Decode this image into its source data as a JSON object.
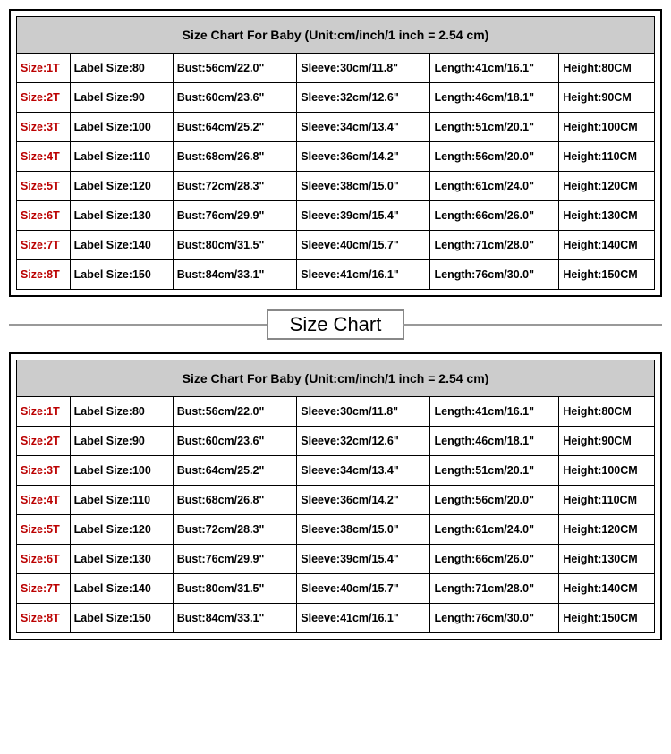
{
  "chart_data": {
    "type": "table",
    "title": "Size Chart For Baby (Unit:cm/inch/1 inch = 2.54 cm)",
    "columns": [
      "Size",
      "Label Size",
      "Bust",
      "Sleeve",
      "Length",
      "Height"
    ],
    "rows": [
      {
        "size": "1T",
        "label": "80",
        "bust": "56cm/22.0\"",
        "sleeve": "30cm/11.8\"",
        "length": "41cm/16.1\"",
        "height": "80CM"
      },
      {
        "size": "2T",
        "label": "90",
        "bust": "60cm/23.6\"",
        "sleeve": "32cm/12.6\"",
        "length": "46cm/18.1\"",
        "height": "90CM"
      },
      {
        "size": "3T",
        "label": "100",
        "bust": "64cm/25.2\"",
        "sleeve": "34cm/13.4\"",
        "length": "51cm/20.1\"",
        "height": "100CM"
      },
      {
        "size": "4T",
        "label": "110",
        "bust": "68cm/26.8\"",
        "sleeve": "36cm/14.2\"",
        "length": "56cm/20.0\"",
        "height": "110CM"
      },
      {
        "size": "5T",
        "label": "120",
        "bust": "72cm/28.3\"",
        "sleeve": "38cm/15.0\"",
        "length": "61cm/24.0\"",
        "height": "120CM"
      },
      {
        "size": "6T",
        "label": "130",
        "bust": "76cm/29.9\"",
        "sleeve": "39cm/15.4\"",
        "length": "66cm/26.0\"",
        "height": "130CM"
      },
      {
        "size": "7T",
        "label": "140",
        "bust": "80cm/31.5\"",
        "sleeve": "40cm/15.7\"",
        "length": "71cm/28.0\"",
        "height": "140CM"
      },
      {
        "size": "8T",
        "label": "150",
        "bust": "84cm/33.1\"",
        "sleeve": "41cm/16.1\"",
        "length": "76cm/30.0\"",
        "height": "150CM"
      }
    ]
  },
  "table1": {
    "header": "Size Chart For Baby (Unit:cm/inch/1 inch = 2.54 cm)"
  },
  "table2": {
    "header": "Size Chart For Baby (Unit:cm/inch/1 inch = 2.54 cm)"
  },
  "divider_label": "Size Chart",
  "labels": {
    "size_prefix": "Size:",
    "label_prefix": "Label Size:",
    "bust_prefix": "Bust:",
    "sleeve_prefix": "Sleeve:",
    "length_prefix": "Length:",
    "height_prefix": "Height:"
  },
  "rows": [
    {
      "size": "1T",
      "label": "80",
      "bust": "56cm/22.0\"",
      "sleeve": "30cm/11.8\"",
      "length": "41cm/16.1\"",
      "height": "80CM"
    },
    {
      "size": "2T",
      "label": "90",
      "bust": "60cm/23.6\"",
      "sleeve": "32cm/12.6\"",
      "length": "46cm/18.1\"",
      "height": "90CM"
    },
    {
      "size": "3T",
      "label": "100",
      "bust": "64cm/25.2\"",
      "sleeve": "34cm/13.4\"",
      "length": "51cm/20.1\"",
      "height": "100CM"
    },
    {
      "size": "4T",
      "label": "110",
      "bust": "68cm/26.8\"",
      "sleeve": "36cm/14.2\"",
      "length": "56cm/20.0\"",
      "height": "110CM"
    },
    {
      "size": "5T",
      "label": "120",
      "bust": "72cm/28.3\"",
      "sleeve": "38cm/15.0\"",
      "length": "61cm/24.0\"",
      "height": "120CM"
    },
    {
      "size": "6T",
      "label": "130",
      "bust": "76cm/29.9\"",
      "sleeve": "39cm/15.4\"",
      "length": "66cm/26.0\"",
      "height": "130CM"
    },
    {
      "size": "7T",
      "label": "140",
      "bust": "80cm/31.5\"",
      "sleeve": "40cm/15.7\"",
      "length": "71cm/28.0\"",
      "height": "140CM"
    },
    {
      "size": "8T",
      "label": "150",
      "bust": "84cm/33.1\"",
      "sleeve": "41cm/16.1\"",
      "length": "76cm/30.0\"",
      "height": "150CM"
    }
  ]
}
